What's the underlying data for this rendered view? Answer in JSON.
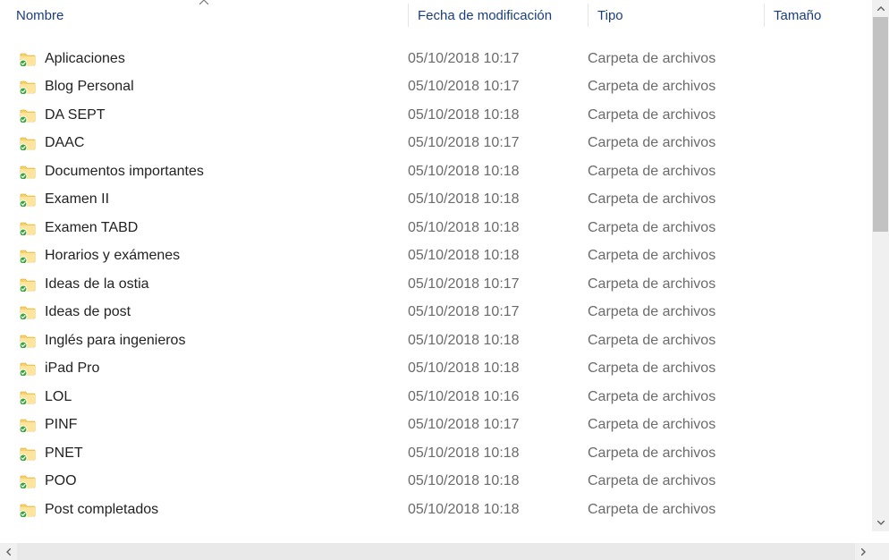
{
  "columns": {
    "name": "Nombre",
    "date": "Fecha de modificación",
    "type": "Tipo",
    "size": "Tamaño"
  },
  "sort": {
    "column": "name",
    "direction": "asc"
  },
  "type_label": "Carpeta de archivos",
  "items": [
    {
      "name": "Aplicaciones",
      "date": "05/10/2018 10:17",
      "type": "Carpeta de archivos",
      "size": ""
    },
    {
      "name": "Blog Personal",
      "date": "05/10/2018 10:17",
      "type": "Carpeta de archivos",
      "size": ""
    },
    {
      "name": "DA SEPT",
      "date": "05/10/2018 10:18",
      "type": "Carpeta de archivos",
      "size": ""
    },
    {
      "name": "DAAC",
      "date": "05/10/2018 10:17",
      "type": "Carpeta de archivos",
      "size": ""
    },
    {
      "name": "Documentos importantes",
      "date": "05/10/2018 10:18",
      "type": "Carpeta de archivos",
      "size": ""
    },
    {
      "name": "Examen II",
      "date": "05/10/2018 10:18",
      "type": "Carpeta de archivos",
      "size": ""
    },
    {
      "name": "Examen TABD",
      "date": "05/10/2018 10:18",
      "type": "Carpeta de archivos",
      "size": ""
    },
    {
      "name": "Horarios y exámenes",
      "date": "05/10/2018 10:18",
      "type": "Carpeta de archivos",
      "size": ""
    },
    {
      "name": "Ideas de la ostia",
      "date": "05/10/2018 10:17",
      "type": "Carpeta de archivos",
      "size": ""
    },
    {
      "name": "Ideas de post",
      "date": "05/10/2018 10:17",
      "type": "Carpeta de archivos",
      "size": ""
    },
    {
      "name": "Inglés para ingenieros",
      "date": "05/10/2018 10:18",
      "type": "Carpeta de archivos",
      "size": ""
    },
    {
      "name": "iPad Pro",
      "date": "05/10/2018 10:18",
      "type": "Carpeta de archivos",
      "size": ""
    },
    {
      "name": "LOL",
      "date": "05/10/2018 10:16",
      "type": "Carpeta de archivos",
      "size": ""
    },
    {
      "name": "PINF",
      "date": "05/10/2018 10:17",
      "type": "Carpeta de archivos",
      "size": ""
    },
    {
      "name": "PNET",
      "date": "05/10/2018 10:18",
      "type": "Carpeta de archivos",
      "size": ""
    },
    {
      "name": "POO",
      "date": "05/10/2018 10:18",
      "type": "Carpeta de archivos",
      "size": ""
    },
    {
      "name": "Post completados",
      "date": "05/10/2018 10:18",
      "type": "Carpeta de archivos",
      "size": ""
    }
  ]
}
